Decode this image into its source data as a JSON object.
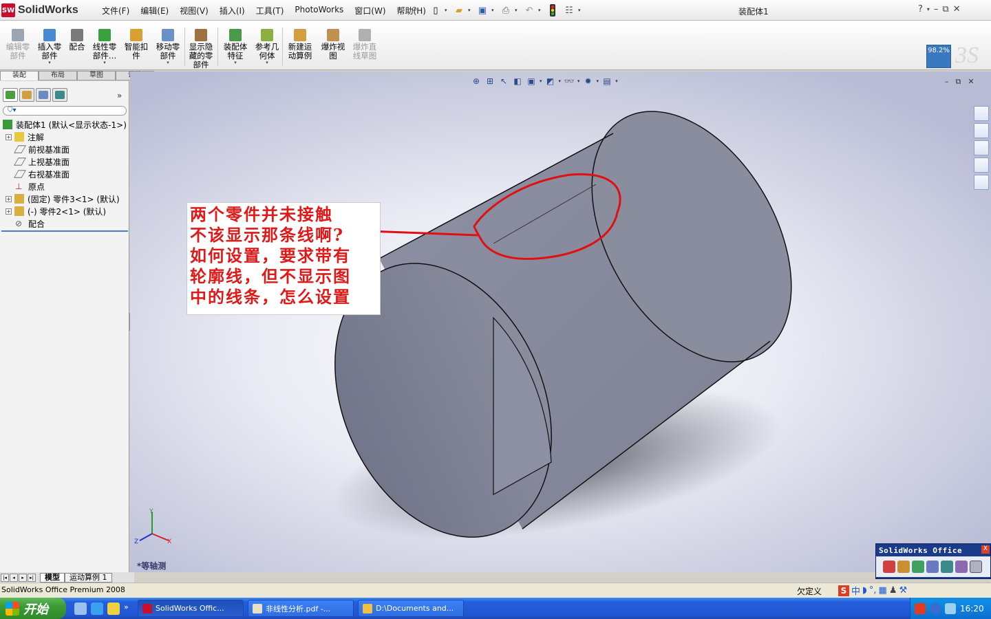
{
  "app": {
    "name": "SolidWorks",
    "doc_title": "装配体1"
  },
  "menu": [
    "文件(F)",
    "编辑(E)",
    "视图(V)",
    "插入(I)",
    "工具(T)",
    "PhotoWorks",
    "窗口(W)",
    "帮助(H)"
  ],
  "winctl": {
    "help": "?",
    "min": "–",
    "restore": "⧉",
    "close": "✕"
  },
  "commands": [
    {
      "label": "编辑零\n部件",
      "disabled": true,
      "color": "#9aa6b4"
    },
    {
      "label": "插入零\n部件",
      "disabled": false,
      "color": "#4a8ad0",
      "arrow": true
    },
    {
      "label": "配合",
      "disabled": false,
      "color": "#7a7a7a"
    },
    {
      "label": "线性零\n部件…",
      "disabled": false,
      "color": "#3aa040",
      "arrow": true
    },
    {
      "label": "智能扣\n件",
      "disabled": false,
      "color": "#d8a030"
    },
    {
      "label": "移动零\n部件",
      "disabled": false,
      "color": "#6a90c8",
      "arrow": true
    },
    {
      "label": "显示隐\n藏的零\n部件",
      "disabled": false,
      "color": "#a07040"
    },
    {
      "label": "装配体\n特征",
      "disabled": false,
      "color": "#4a9a4a",
      "arrow": true
    },
    {
      "label": "参考几\n何体",
      "disabled": false,
      "color": "#8ab040",
      "arrow": true
    },
    {
      "label": "新建运\n动算例",
      "disabled": false,
      "color": "#d0a040"
    },
    {
      "label": "爆炸视\n图",
      "disabled": false,
      "color": "#c09050"
    },
    {
      "label": "爆炸直\n线草图",
      "disabled": true,
      "color": "#b0b0b0"
    }
  ],
  "zoom": "98.2%",
  "cm_tabs": [
    "装配",
    "布局",
    "草图",
    "评估"
  ],
  "tree": [
    {
      "label": "装配体1 (默认<显示状态-1>)",
      "icon": "assembly-icon",
      "pm": "",
      "indent": 4
    },
    {
      "label": "注解",
      "icon": "annotation-icon",
      "pm": "+",
      "indent": 8
    },
    {
      "label": "前视基准面",
      "icon": "plane-icon",
      "pm": "",
      "indent": 22
    },
    {
      "label": "上视基准面",
      "icon": "plane-icon",
      "pm": "",
      "indent": 22
    },
    {
      "label": "右视基准面",
      "icon": "plane-icon",
      "pm": "",
      "indent": 22
    },
    {
      "label": "原点",
      "icon": "origin-icon",
      "pm": "",
      "indent": 22
    },
    {
      "label": "(固定) 零件3<1> (默认)",
      "icon": "part-icon",
      "pm": "+",
      "indent": 8
    },
    {
      "label": "(-) 零件2<1> (默认)",
      "icon": "part-icon",
      "pm": "+",
      "indent": 8
    },
    {
      "label": "配合",
      "icon": "mates-icon",
      "pm": "",
      "indent": 22
    }
  ],
  "annotation_lines": [
    "两个零件并未接触",
    "不该显示那条线啊?",
    "如何设置，要求带有",
    "轮廓线，但不显示图",
    "中的线条，怎么设置"
  ],
  "view_label": "*等轴测",
  "axis": {
    "x": "X",
    "y": "Y",
    "z": "Z"
  },
  "bottom_tabs": [
    "模型",
    "运动算例 1"
  ],
  "status": {
    "left": "SolidWorks Office Premium 2008",
    "right": "欠定义"
  },
  "swoffice": {
    "title": "SolidWorks Office",
    "close": "X"
  },
  "taskbar": {
    "start": "开始",
    "tasks": [
      "SolidWorks Offic...",
      "非线性分析.pdf -...",
      "D:\\Documents and..."
    ],
    "clock": "16:20"
  }
}
